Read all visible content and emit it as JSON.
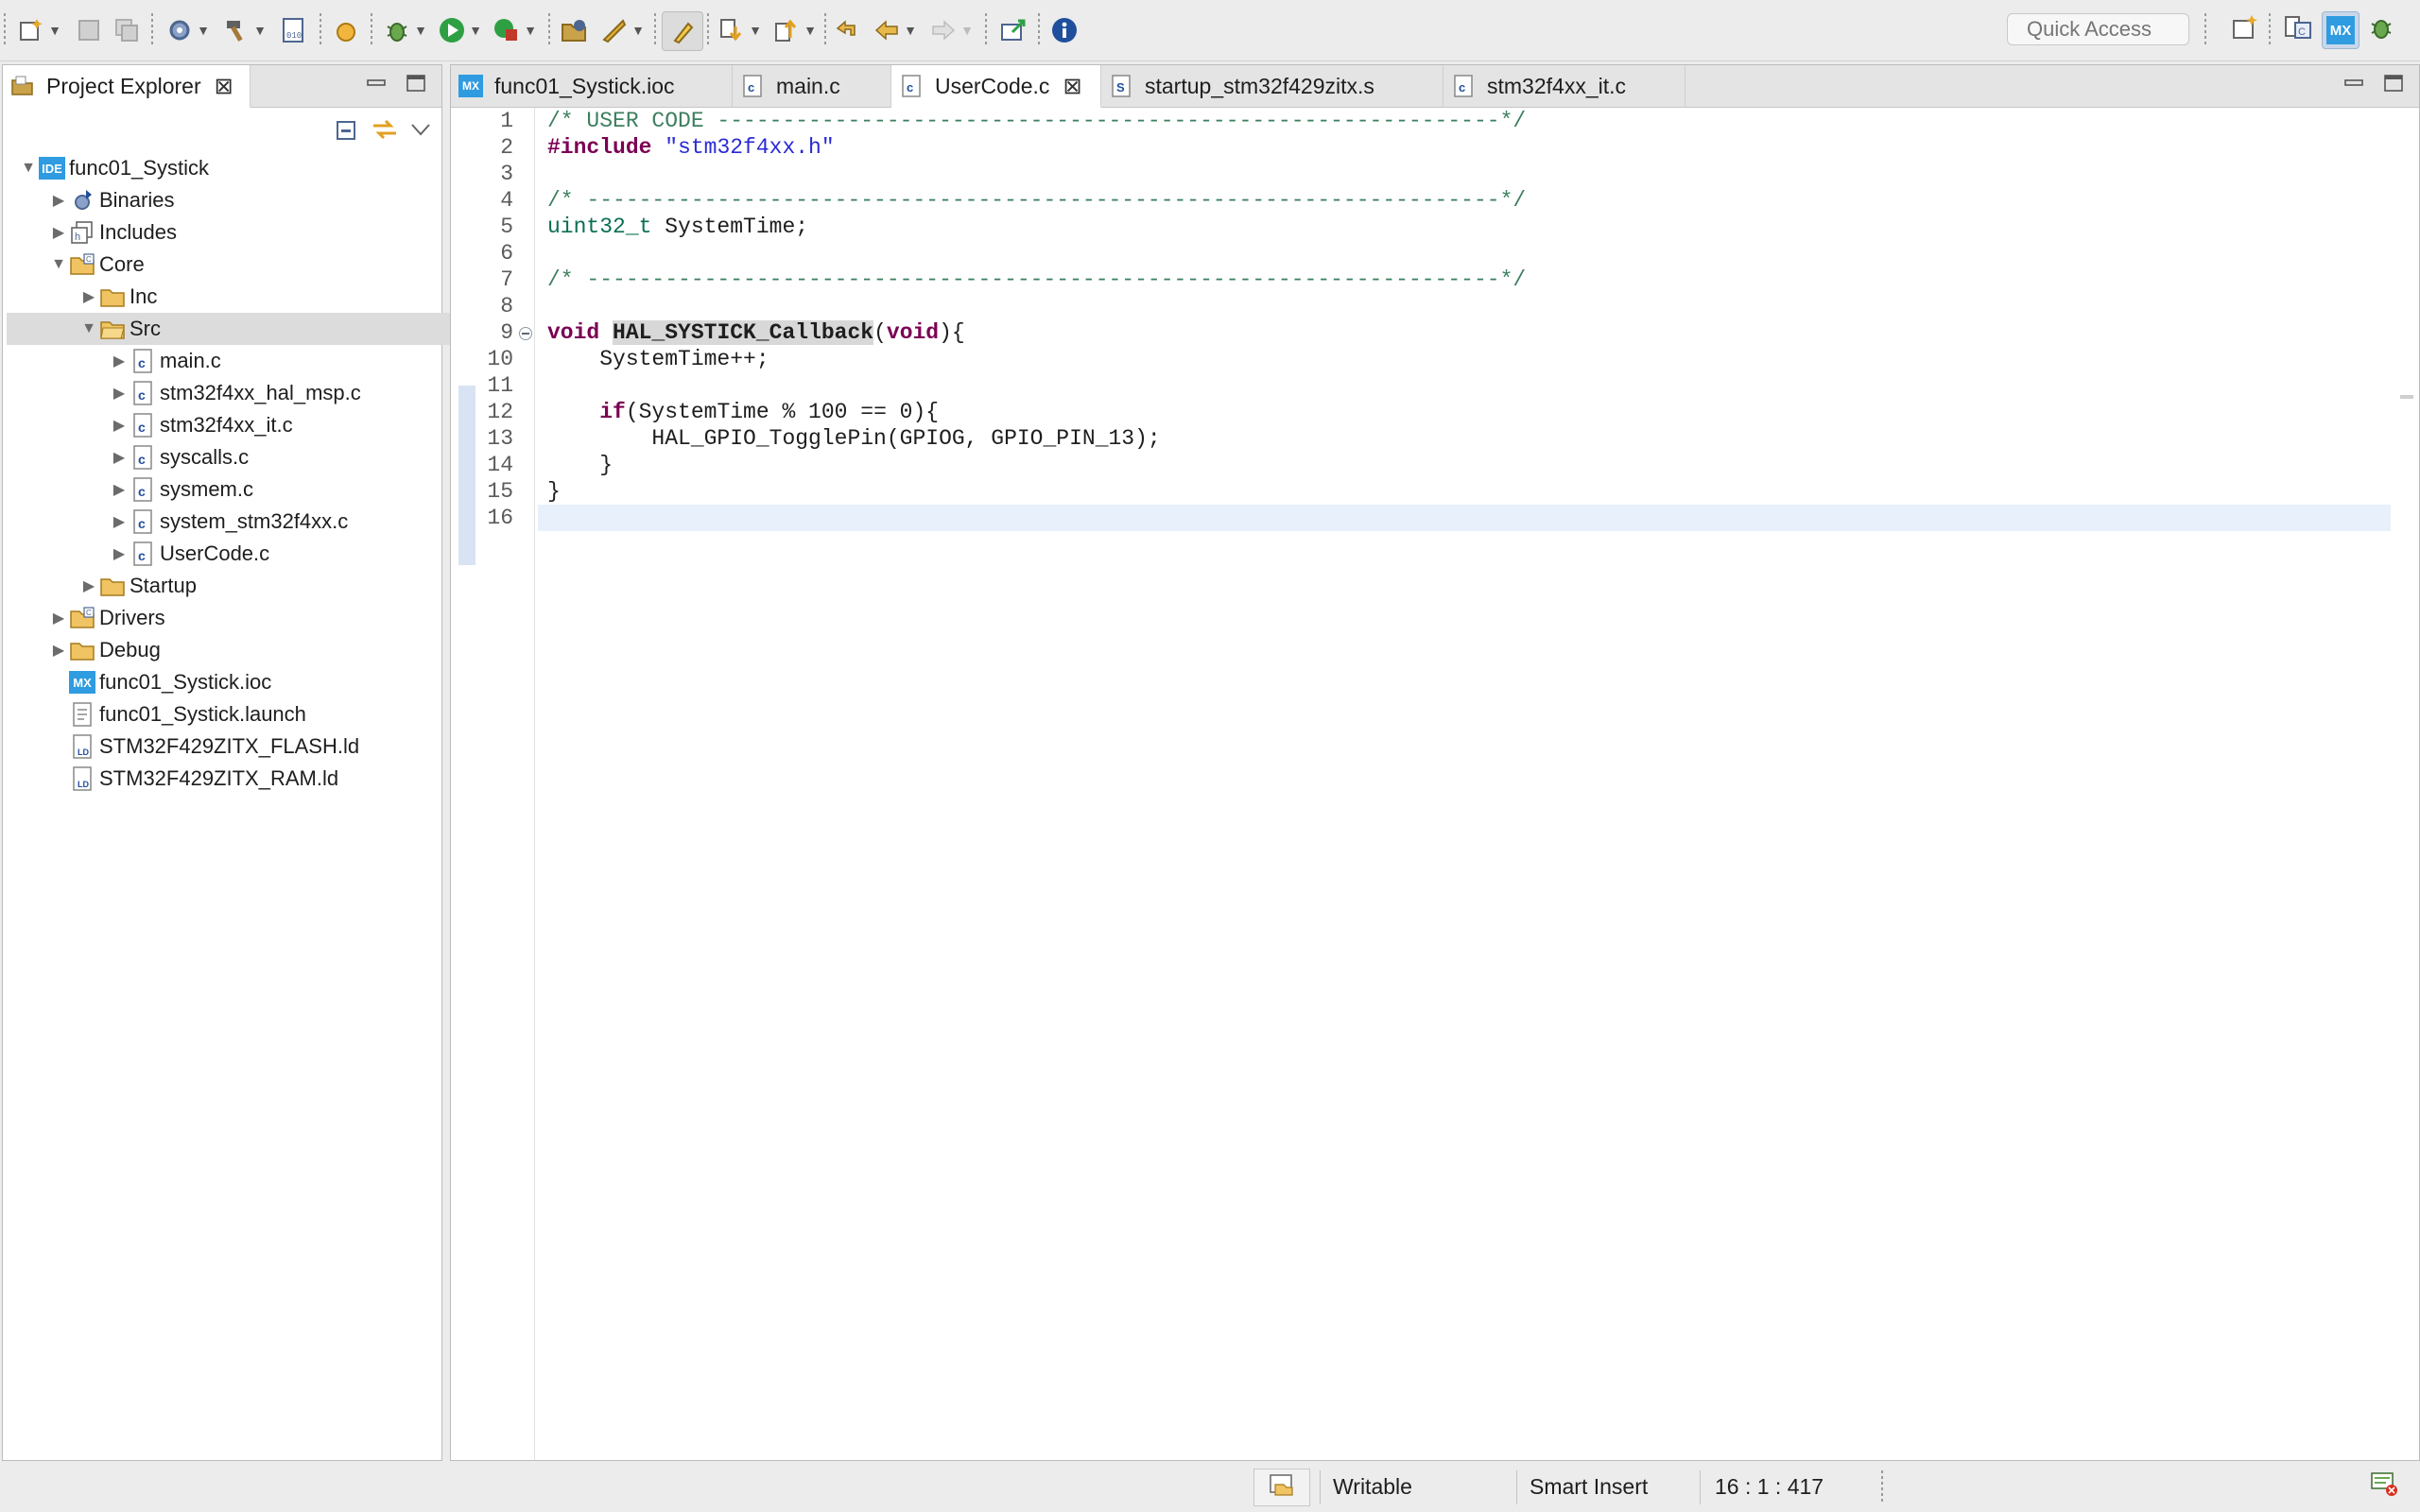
{
  "toolbar": {
    "quick_access_placeholder": "Quick Access",
    "perspective_mx_label": "MX"
  },
  "explorer": {
    "title": "Project Explorer",
    "tree": [
      {
        "label": "func01_Systick",
        "icon": "ide-project-icon",
        "expanded": true
      },
      {
        "label": "Binaries",
        "icon": "binaries-icon",
        "expanded": false
      },
      {
        "label": "Includes",
        "icon": "includes-icon",
        "expanded": false
      },
      {
        "label": "Core",
        "icon": "folder-icon",
        "expanded": true
      },
      {
        "label": "Inc",
        "icon": "folder-icon",
        "expanded": false
      },
      {
        "label": "Src",
        "icon": "folder-icon",
        "expanded": true,
        "selected": true
      },
      {
        "label": "main.c",
        "icon": "c-file-icon"
      },
      {
        "label": "stm32f4xx_hal_msp.c",
        "icon": "c-file-icon"
      },
      {
        "label": "stm32f4xx_it.c",
        "icon": "c-file-icon"
      },
      {
        "label": "syscalls.c",
        "icon": "c-file-icon"
      },
      {
        "label": "sysmem.c",
        "icon": "c-file-icon"
      },
      {
        "label": "system_stm32f4xx.c",
        "icon": "c-file-icon"
      },
      {
        "label": "UserCode.c",
        "icon": "c-file-icon"
      },
      {
        "label": "Startup",
        "icon": "folder-icon",
        "expanded": false
      },
      {
        "label": "Drivers",
        "icon": "folder-icon",
        "expanded": false
      },
      {
        "label": "Debug",
        "icon": "folder-icon",
        "expanded": false
      },
      {
        "label": "func01_Systick.ioc",
        "icon": "mx-file-icon"
      },
      {
        "label": "func01_Systick.launch",
        "icon": "launch-file-icon"
      },
      {
        "label": "STM32F429ZITX_FLASH.ld",
        "icon": "ld-file-icon"
      },
      {
        "label": "STM32F429ZITX_RAM.ld",
        "icon": "ld-file-icon"
      }
    ],
    "ide_badge": "IDE",
    "mx_badge": "MX"
  },
  "editor": {
    "tabs": [
      {
        "label": "func01_Systick.ioc",
        "icon": "mx-file-icon",
        "active": false
      },
      {
        "label": "main.c",
        "icon": "c-file-icon",
        "active": false
      },
      {
        "label": "UserCode.c",
        "icon": "c-file-icon",
        "active": true
      },
      {
        "label": "startup_stm32f429zitx.s",
        "icon": "s-file-icon",
        "active": false
      },
      {
        "label": "stm32f4xx_it.c",
        "icon": "c-file-icon",
        "active": false
      }
    ],
    "line_numbers": [
      "1",
      "2",
      "3",
      "4",
      "5",
      "6",
      "7",
      "8",
      "9",
      "10",
      "11",
      "12",
      "13",
      "14",
      "15",
      "16"
    ],
    "code": {
      "l1": "/* USER CODE ------------------------------------------------------------*/",
      "l2_kw": "#include",
      "l2_str": "\"stm32f4xx.h\"",
      "l4": "/* ----------------------------------------------------------------------*/",
      "l5_type": "uint32_t",
      "l5_rest": " SystemTime;",
      "l7": "/* ----------------------------------------------------------------------*/",
      "l9_kw": "void",
      "l9_fn": "HAL_SYSTICK_Callback",
      "l9_open": "(",
      "l9_kw2": "void",
      "l9_close": "){",
      "l10": "    SystemTime++;",
      "l12_indent": "    ",
      "l12_kw": "if",
      "l12_rest": "(SystemTime % 100 == 0){",
      "l13": "        HAL_GPIO_TogglePin(GPIOG, GPIO_PIN_13);",
      "l14": "    }",
      "l15": "}"
    }
  },
  "status": {
    "writable": "Writable",
    "insert_mode": "Smart Insert",
    "position": "16 : 1 : 417"
  }
}
